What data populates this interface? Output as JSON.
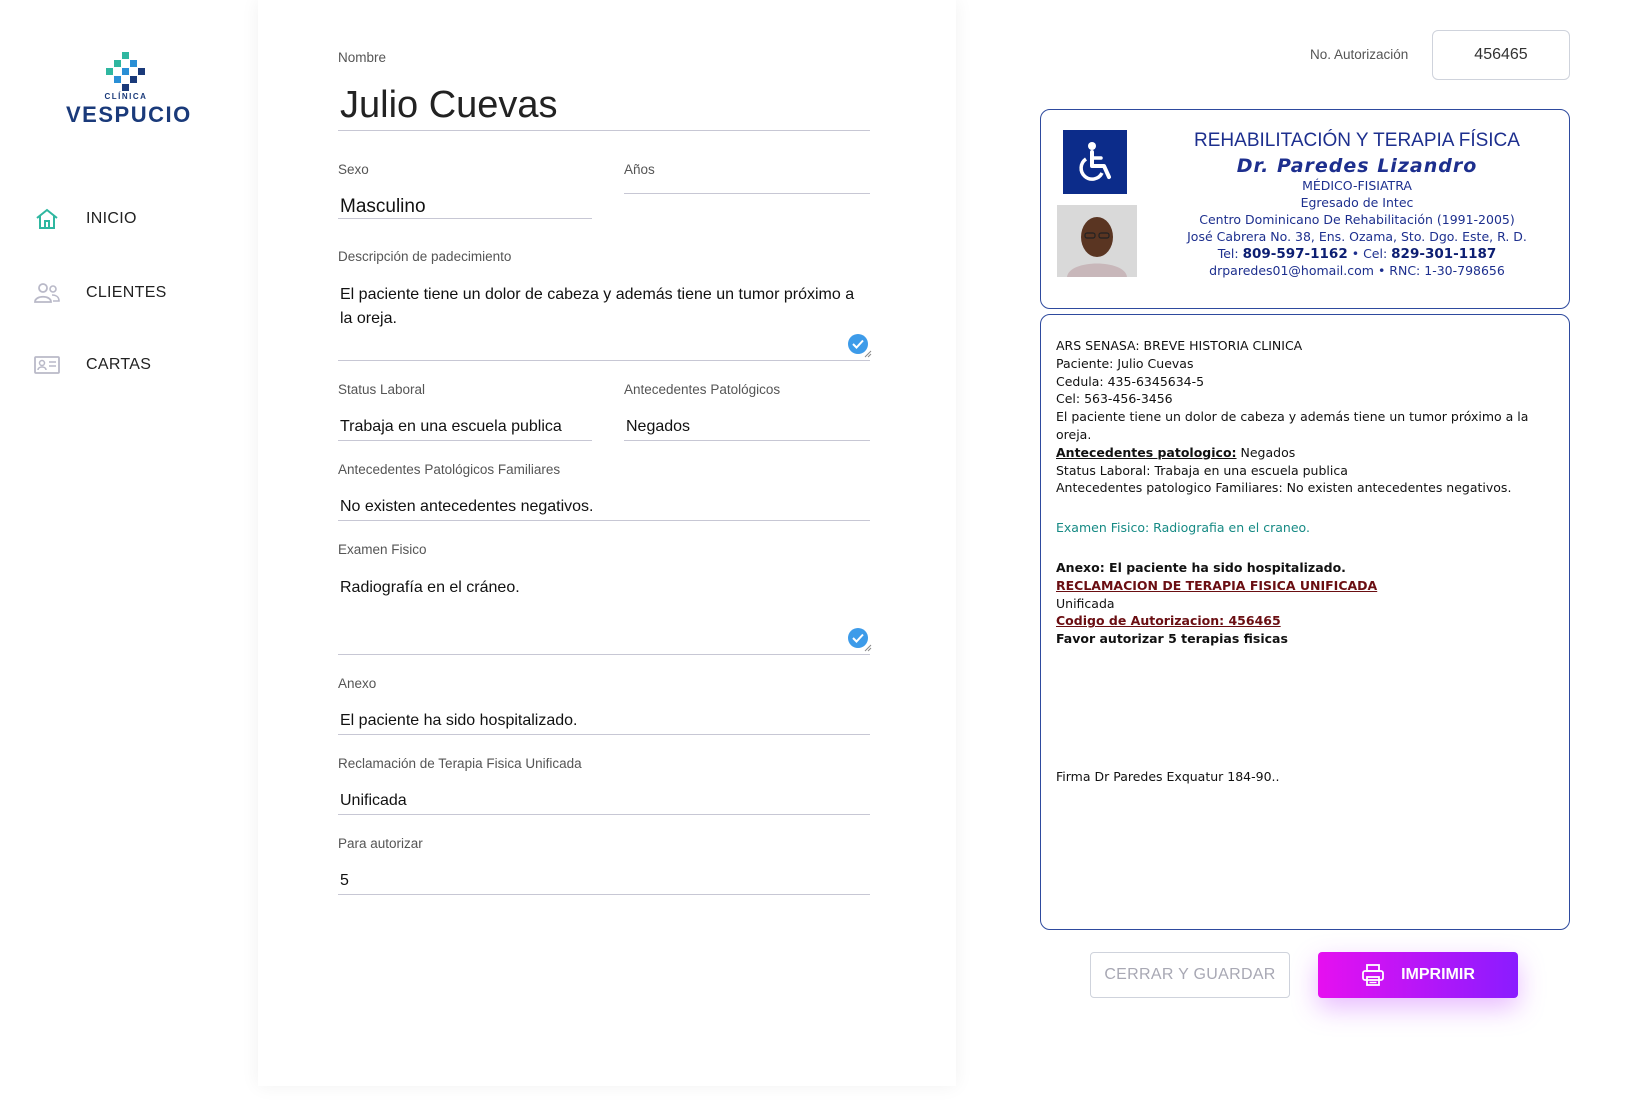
{
  "sidebar": {
    "logo": {
      "sub": "CLÍNICA",
      "name": "VESPUCIO"
    },
    "items": [
      {
        "label": "INICIO",
        "icon": "home-icon",
        "active": true
      },
      {
        "label": "CLIENTES",
        "icon": "users-icon"
      },
      {
        "label": "CARTAS",
        "icon": "id-card-icon"
      }
    ]
  },
  "form": {
    "nombre": {
      "label": "Nombre",
      "value": "Julio Cuevas"
    },
    "sexo": {
      "label": "Sexo",
      "value": "Masculino"
    },
    "anos": {
      "label": "Años",
      "value": ""
    },
    "descripcion": {
      "label": "Descripción de padecimiento",
      "value": "El paciente tiene un dolor de cabeza y además tiene un tumor próximo a la oreja."
    },
    "status": {
      "label": "Status Laboral",
      "value": "Trabaja en una escuela publica"
    },
    "antecedentes": {
      "label": "Antecedentes Patológicos",
      "value": "Negados"
    },
    "familiares": {
      "label": "Antecedentes Patológicos Familiares",
      "value": "No existen antecedentes negativos."
    },
    "examen": {
      "label": "Examen Fisico",
      "value": "Radiografía en el cráneo."
    },
    "anexo": {
      "label": "Anexo",
      "value": "El paciente ha sido hospitalizado."
    },
    "reclamacion": {
      "label": "Reclamación de Terapia Fisica Unificada",
      "value": "Unificada"
    },
    "autorizar": {
      "label": "Para autorizar",
      "value": "5"
    }
  },
  "authorization": {
    "label": "No. Autorización",
    "value": "456465"
  },
  "letterhead": {
    "title": "REHABILITACIÓN Y TERAPIA FÍSICA",
    "doctor": "Dr. Paredes Lizandro",
    "specialty": "MÉDICO-FISIATRA",
    "education": "Egresado de Intec",
    "center": "Centro Dominicano De Rehabilitación (1991-2005)",
    "address": "José Cabrera No. 38, Ens. Ozama, Sto. Dgo. Este, R. D.",
    "tel_label": "Tel:",
    "tel": "809-597-1162",
    "cel_label": "Cel:",
    "cel": "829-301-1187",
    "email": "drparedes01@homail.com",
    "rnc": "RNC: 1-30-798656"
  },
  "document": {
    "line1": "ARS SENASA: BREVE HISTORIA CLINICA",
    "paciente": "Paciente: Julio Cuevas",
    "cedula": "Cedula: 435-6345634-5",
    "cel": "Cel: 563-456-3456",
    "descripcion": "El paciente tiene un dolor de cabeza y además tiene un tumor próximo a la oreja.",
    "antecedentes_label": "Antecedentes patologico:",
    "antecedentes_value": " Negados",
    "status": "Status Laboral: Trabaja en una escuela publica",
    "familiares": "Antecedentes patologico Familiares: No existen antecedentes negativos.",
    "examen": "Examen Fisico: Radiografia en el craneo.",
    "anexo": "Anexo: El paciente ha sido hospitalizado.",
    "reclamacion_title": "RECLAMACION DE TERAPIA FISICA UNIFICADA",
    "reclamacion_value": "Unificada",
    "codigo": "Codigo de Autorizacion: 456465",
    "favor": "Favor autorizar 5 terapias fisicas",
    "firma": "Firma Dr Paredes Exquatur 184-90.."
  },
  "buttons": {
    "close": "CERRAR Y GUARDAR",
    "print": "IMPRIMIR"
  },
  "colors": {
    "accent_teal": "#2fb7a0",
    "letterhead_blue": "#1d2f8e",
    "print_start": "#e610f0",
    "print_end": "#8a1cff"
  }
}
